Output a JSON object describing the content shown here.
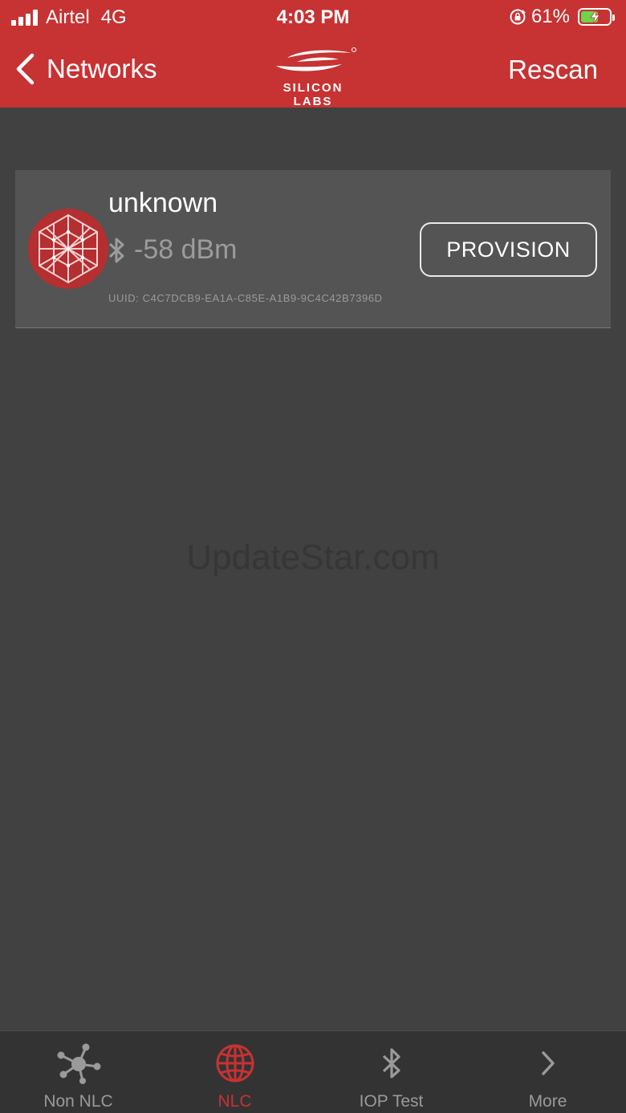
{
  "status_bar": {
    "carrier": "Airtel",
    "network": "4G",
    "time": "4:03 PM",
    "battery_percent": "61%",
    "battery_level": 0.61,
    "icons": [
      "signal-icon",
      "rotation-lock-icon",
      "battery-charging-icon"
    ]
  },
  "nav": {
    "back_label": "Networks",
    "logo_text": "SILICON LABS",
    "rescan_label": "Rescan"
  },
  "device": {
    "name": "unknown",
    "rssi": "-58 dBm",
    "uuid": "UUID: C4C7DCB9-EA1A-C85E-A1B9-9C4C42B7396D",
    "provision_label": "PROVISION",
    "icon": "mesh-hexagon-icon"
  },
  "watermark": "UpdateStar.com",
  "tabs": [
    {
      "label": "Non NLC",
      "icon": "network-nodes-icon",
      "active": false
    },
    {
      "label": "NLC",
      "icon": "globe-icon",
      "active": true
    },
    {
      "label": "IOP Test",
      "icon": "bluetooth-icon",
      "active": false
    },
    {
      "label": "More",
      "icon": "chevron-right-icon",
      "active": false
    }
  ],
  "colors": {
    "accent": "#c73233",
    "background": "#414141",
    "card": "#545454",
    "tab_bar": "#333333",
    "inactive": "#9a9a9a"
  }
}
